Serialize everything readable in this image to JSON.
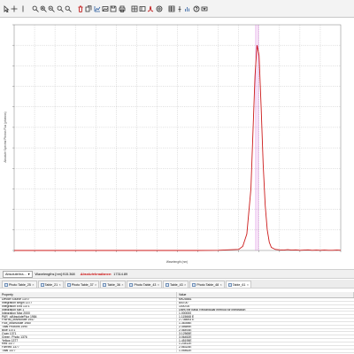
{
  "toolbar": {
    "icons": [
      "pointer-icon",
      "move-icon",
      "vertical-cursor-icon",
      "magnifier-icon",
      "zoom-in-icon",
      "zoom-out-icon",
      "zoom-fit-icon",
      "zoom-reset-icon",
      "delete-icon",
      "copy-icon",
      "chart-icon",
      "image-icon",
      "save-icon",
      "print-icon",
      "grid-icon",
      "legend-icon",
      "peak-icon",
      "settings-icon",
      "table-icon",
      "pin-icon",
      "bar-chart-icon",
      "help-icon",
      "dropdown-icon"
    ]
  },
  "plot": {
    "ylabel": "Absolute Spectral Photon Flux (photons)",
    "xlabel": "Wavelength (nm)",
    "line_color": "#cc1a1a",
    "marker_color": "#d36fd8"
  },
  "chart_data": {
    "type": "line",
    "series": [
      {
        "x": [
          200,
          250,
          300,
          350,
          400,
          450,
          500,
          550,
          600,
          650,
          700,
          750,
          760,
          770,
          780,
          790,
          795,
          800,
          805,
          810,
          815,
          820,
          825,
          830,
          840,
          850,
          860,
          870,
          880,
          890,
          900,
          910,
          920,
          930,
          940,
          950,
          960,
          970,
          980,
          990,
          1000
        ],
        "y": [
          0,
          0,
          0,
          0,
          0,
          0,
          0,
          0,
          0,
          0,
          0.001,
          0.005,
          0.02,
          0.08,
          0.3,
          0.85,
          1.0,
          0.95,
          0.7,
          0.42,
          0.22,
          0.1,
          0.04,
          0.015,
          0.005,
          0.003,
          0.002,
          0.004,
          0.002,
          0.003,
          0.001,
          0.002,
          0.003,
          0.001,
          0.002,
          0.001,
          0.002,
          0.001,
          0.001,
          0.002,
          0.001
        ]
      }
    ],
    "xlim": [
      200,
      1000
    ],
    "grid": true,
    "markers_x": [
      792,
      798
    ]
  },
  "statusbar": {
    "dropdown_value": "AbsoluteIrra...",
    "wavelength_text": "Wavelengths [nm]:915.368",
    "irradiance_label": "AbsoluteIrradiance:",
    "irradiance_value": "17314.89"
  },
  "tabs": [
    {
      "label": "Photo Table_25",
      "active": false
    },
    {
      "label": "Table_21",
      "active": false
    },
    {
      "label": "Photo Table_37",
      "active": false
    },
    {
      "label": "Table_36",
      "active": false
    },
    {
      "label": "Photo Table_43",
      "active": false
    },
    {
      "label": "Table_43",
      "active": false
    },
    {
      "label": "Photo Table_48",
      "active": false
    },
    {
      "label": "Table_61",
      "active": true
    }
  ],
  "table": {
    "headers": [
      "Property",
      "Value"
    ],
    "rows": [
      [
        "Device Source 1370",
        "MK28861"
      ],
      [
        "Integration Begin 1377",
        "800.00"
      ],
      [
        "Integration End 1371",
        "1000.00"
      ],
      [
        "Integration Min 1",
        "Uses the basic Rectangular method for integration"
      ],
      [
        "Integration Max 2000",
        "1.000000"
      ],
      [
        "PAR_ofAbsoluteFlux 1984",
        "1.115668 E"
      ],
      [
        "FWHM_ofAbsolute 1947",
        "2.736693 E"
      ],
      [
        "Flux_ofAbsolute 1980",
        "1.36398E"
      ],
      [
        "Total Photons 1990",
        "2.45689E"
      ],
      [
        "Blue 1371",
        "2.46493E"
      ],
      [
        "Cyan 1371",
        "3.12565E"
      ],
      [
        "Green_Photo 1376",
        "3.06452E"
      ],
      [
        "Yellow 1377",
        "1.45195E"
      ],
      [
        "Red 1377",
        "1.23412E"
      ],
      [
        "FarRed 1377",
        "2.56324E"
      ],
      [
        "Total 1377",
        "1.05462E"
      ]
    ]
  }
}
